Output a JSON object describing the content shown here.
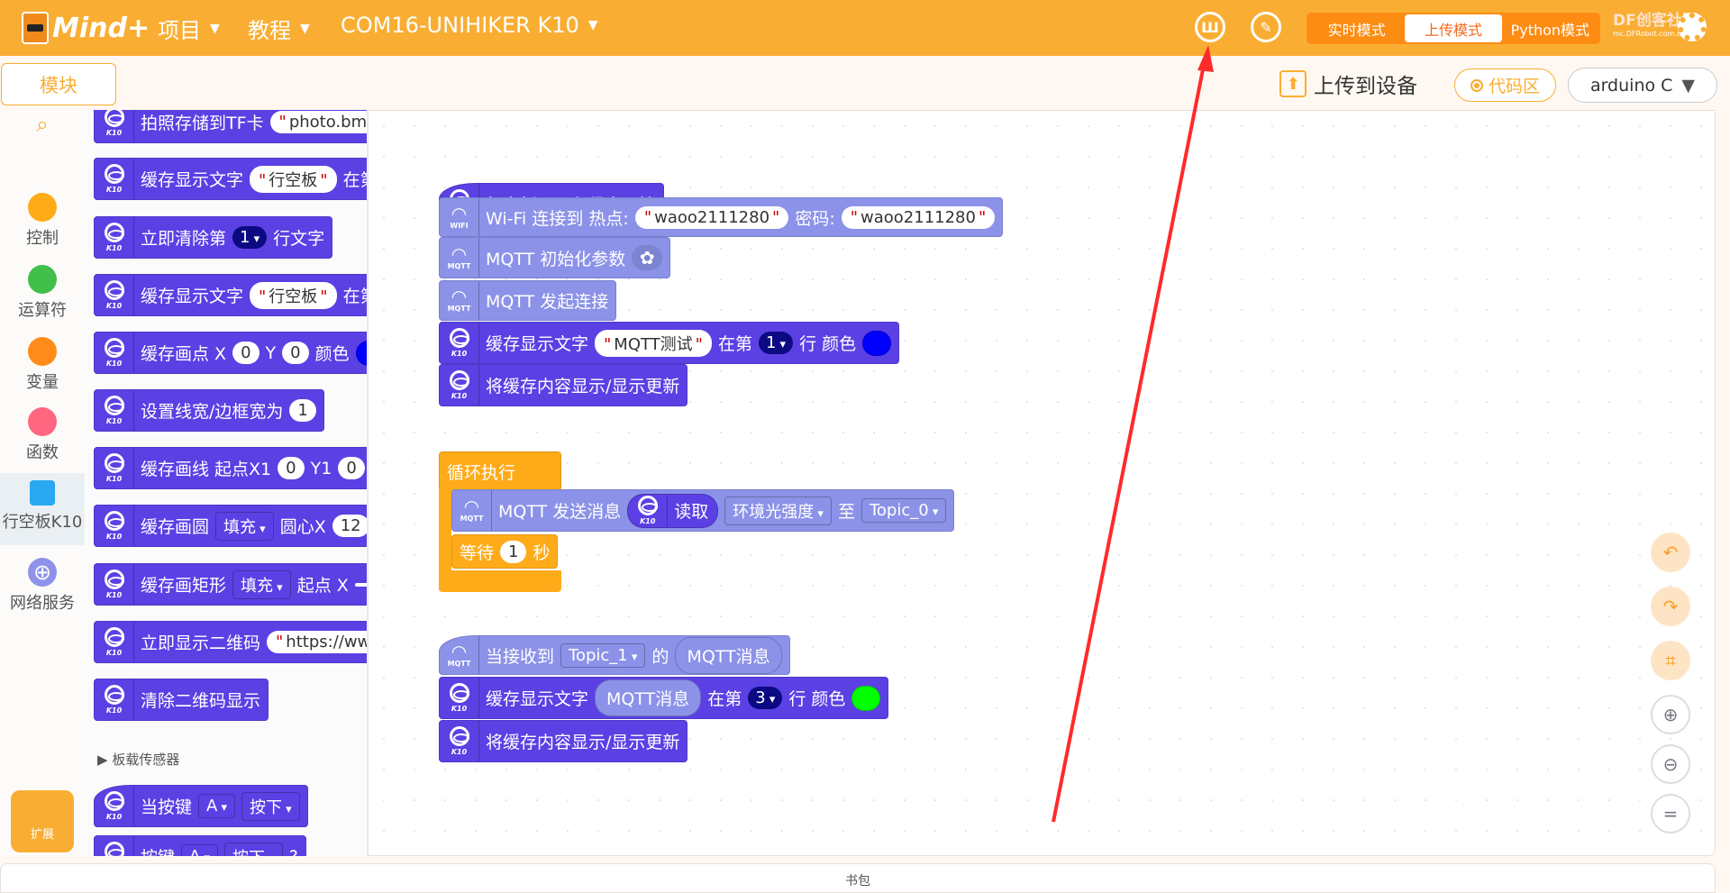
{
  "header": {
    "logo": "Mind+",
    "menus": [
      {
        "label": "项目"
      },
      {
        "label": "教程"
      },
      {
        "label": "COM16-UNIHIKER K10"
      }
    ],
    "icons": [
      "dashboard-icon",
      "edit-icon"
    ],
    "modes": [
      {
        "label": "实时模式"
      },
      {
        "label": "上传模式",
        "active": true
      },
      {
        "label": "Python模式"
      }
    ],
    "community": "DF创客社区",
    "community_url": "mc.DFRobot.com.cn"
  },
  "toolbar": {
    "modules_tab": "模块",
    "upload": "上传到设备",
    "code_area": "代码区",
    "language": "arduino C"
  },
  "categories": [
    {
      "label": "控制",
      "color": "#ffab19"
    },
    {
      "label": "运算符",
      "color": "#40bf4a"
    },
    {
      "label": "变量",
      "color": "#ff8c1a"
    },
    {
      "label": "函数",
      "color": "#ff6680"
    },
    {
      "label": "行空板K10",
      "selected": true
    },
    {
      "label": "网络服务"
    }
  ],
  "extension": "扩展",
  "palette": {
    "section": "板载传感器",
    "blocks": [
      [
        {
          "t": "拍照存储到TF卡"
        },
        {
          "s": "photo.bm"
        }
      ],
      [
        {
          "t": "缓存显示文字"
        },
        {
          "s": "行空板"
        },
        {
          "t": "在第"
        }
      ],
      [
        {
          "t": "立即清除第"
        },
        {
          "dd": "1"
        },
        {
          "t": "行文字"
        }
      ],
      [
        {
          "t": "缓存显示文字"
        },
        {
          "s": "行空板"
        },
        {
          "t": "在第"
        }
      ],
      [
        {
          "t": "缓存画点 X"
        },
        {
          "n": "0"
        },
        {
          "t": "Y"
        },
        {
          "n": "0"
        },
        {
          "t": "颜色"
        },
        {
          "c": "#0000ff"
        }
      ],
      [
        {
          "t": "设置线宽/边框宽为"
        },
        {
          "n": "1"
        }
      ],
      [
        {
          "t": "缓存画线 起点X1"
        },
        {
          "n": "0"
        },
        {
          "t": "Y1"
        },
        {
          "n": "0"
        }
      ],
      [
        {
          "t": "缓存画圆"
        },
        {
          "d": "填充"
        },
        {
          "t": "圆心X"
        },
        {
          "n": "12"
        }
      ],
      [
        {
          "t": "缓存画矩形"
        },
        {
          "d": "填充"
        },
        {
          "t": "起点 X"
        },
        {
          "n": ""
        }
      ],
      [
        {
          "t": "立即显示二维码"
        },
        {
          "s": "https://ww"
        }
      ],
      [
        {
          "t": "清除二维码显示"
        }
      ],
      [
        {
          "t": "当按键"
        },
        {
          "d": "A"
        },
        {
          "d": "按下"
        }
      ],
      [
        {
          "t": "按键"
        },
        {
          "d": "A"
        },
        {
          "d": "按下"
        },
        {
          "t": "?"
        }
      ]
    ]
  },
  "canvas": {
    "blocks": [
      {
        "kind": "k10",
        "hat": true,
        "parts": [
          {
            "t": "行空板K10主程序开始"
          }
        ]
      },
      {
        "kind": "mqtt",
        "icon": "WIFI",
        "parts": [
          {
            "t": "Wi-Fi 连接到 热点:"
          },
          {
            "s": "waoo2111280"
          },
          {
            "t": "密码:"
          },
          {
            "s": "waoo2111280"
          }
        ]
      },
      {
        "kind": "mqtt",
        "icon": "MQTT",
        "parts": [
          {
            "t": "MQTT 初始化参数"
          },
          {
            "g": "✿"
          }
        ]
      },
      {
        "kind": "mqtt",
        "icon": "MQTT",
        "parts": [
          {
            "t": "MQTT 发起连接"
          }
        ]
      },
      {
        "kind": "k10",
        "parts": [
          {
            "t": "缓存显示文字"
          },
          {
            "s": "MQTT测试"
          },
          {
            "t": "在第"
          },
          {
            "dd": "1"
          },
          {
            "t": "行 颜色"
          },
          {
            "c": "#0000ff"
          }
        ]
      },
      {
        "kind": "k10",
        "parts": [
          {
            "t": "将缓存内容显示/显示更新"
          }
        ]
      },
      {
        "kind": "ctrl",
        "parts": [
          {
            "t": "循环执行"
          }
        ]
      },
      {
        "kind": "mqtt",
        "icon": "MQTT",
        "parts": [
          {
            "t": "MQTT 发送消息"
          },
          {
            "rk": "读取"
          },
          {
            "d": "环境光强度"
          },
          {
            "t": "至"
          },
          {
            "d": "Topic_0"
          }
        ]
      },
      {
        "kind": "ctrl",
        "parts": [
          {
            "t": "等待"
          },
          {
            "n": "1"
          },
          {
            "t": "秒"
          }
        ]
      },
      {
        "kind": "mqtt",
        "icon": "MQTT",
        "hat": true,
        "parts": [
          {
            "t": "当接收到"
          },
          {
            "d": "Topic_1"
          },
          {
            "t": "的"
          },
          {
            "r": "MQTT消息"
          }
        ]
      },
      {
        "kind": "k10",
        "parts": [
          {
            "t": "缓存显示文字"
          },
          {
            "r": "MQTT消息"
          },
          {
            "t": "在第"
          },
          {
            "dd": "3"
          },
          {
            "t": "行 颜色"
          },
          {
            "c": "#00ff00"
          }
        ]
      },
      {
        "kind": "k10",
        "parts": [
          {
            "t": "将缓存内容显示/显示更新"
          }
        ]
      }
    ]
  },
  "controls": [
    "undo-icon",
    "redo-icon",
    "crop-icon",
    "zoom-in-icon",
    "zoom-out-icon",
    "reset-zoom-icon"
  ],
  "backpack": "书包",
  "colors": {
    "topbar": "#f9ae33",
    "k10_block": "#5b40e4",
    "mqtt_block": "#8b92e8",
    "control_block": "#ffab19",
    "annotation_arrow": "#ff2a2a"
  }
}
